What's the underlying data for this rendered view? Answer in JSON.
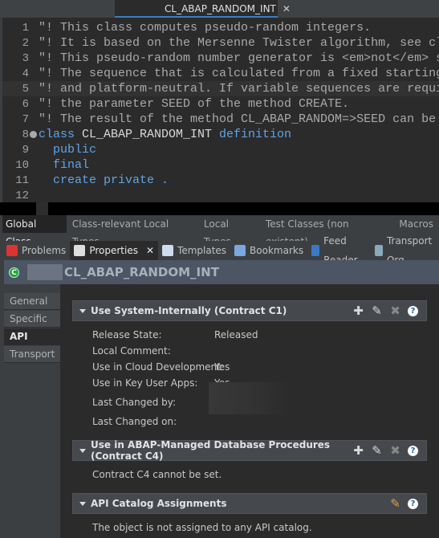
{
  "editor": {
    "tab_title": "CL_ABAP_RANDOM_INT",
    "lines": [
      {
        "n": "1",
        "parts": [
          [
            "cm",
            "\"! This class computes pseudo-random integers."
          ]
        ]
      },
      {
        "n": "2",
        "parts": [
          [
            "cm",
            "\"! It is based on the Mersenne Twister algorithm, see cl"
          ]
        ]
      },
      {
        "n": "3",
        "parts": [
          [
            "cm",
            "\"! This pseudo-random number generator is <em>not</em> s"
          ]
        ]
      },
      {
        "n": "4",
        "parts": [
          [
            "cm",
            "\"! The sequence that is calculated from a fixed starting"
          ]
        ]
      },
      {
        "n": "5",
        "parts": [
          [
            "cm",
            "\"! and platform-neutral. If variable sequences are requi"
          ]
        ]
      },
      {
        "n": "6",
        "parts": [
          [
            "cm",
            "\"! the parameter SEED of the method CREATE."
          ]
        ]
      },
      {
        "n": "7",
        "parts": [
          [
            "cm",
            "\"! The result of the method CL_ABAP_RANDOM=>SEED can be"
          ]
        ]
      },
      {
        "n": "8",
        "parts": [
          [
            "kw",
            "class "
          ],
          [
            "id",
            "CL_ABAP_RANDOM_INT "
          ],
          [
            "kw",
            "definition"
          ]
        ]
      },
      {
        "n": "9",
        "parts": [
          [
            "kw",
            "  public"
          ]
        ]
      },
      {
        "n": "10",
        "parts": [
          [
            "kw",
            "  final"
          ]
        ]
      },
      {
        "n": "11",
        "parts": [
          [
            "kw",
            "  create private ."
          ]
        ]
      },
      {
        "n": "12",
        "parts": []
      }
    ]
  },
  "subtabs": [
    "Global Class",
    "Class-relevant Local Types",
    "Local Types",
    "Test Classes (non existent)",
    "Macros"
  ],
  "viewtabs": [
    {
      "label": "Problems",
      "icon": "problems-icon",
      "color": "#d33"
    },
    {
      "label": "Properties",
      "icon": "properties-icon",
      "color": "#ddd"
    },
    {
      "label": "Templates",
      "icon": "templates-icon",
      "color": "#cde"
    },
    {
      "label": "Bookmarks",
      "icon": "bookmarks-icon",
      "color": "#7aa7e0"
    },
    {
      "label": "Feed Reader",
      "icon": "feed-icon",
      "color": "#3a78c8"
    },
    {
      "label": "Transport Org",
      "icon": "transport-icon",
      "color": "#8ab"
    }
  ],
  "properties": {
    "class_icon": "C",
    "title": "CL_ABAP_RANDOM_INT",
    "nav": [
      "General",
      "Specific",
      "API State",
      "Transport"
    ],
    "sections": [
      {
        "title": "Use System-Internally (Contract C1)",
        "fields": [
          [
            "Release State:",
            "Released"
          ],
          [
            "Local Comment:",
            ""
          ],
          [
            "Use in Cloud Development:",
            "Yes"
          ],
          [
            "Use in Key User Apps:",
            "Yes"
          ],
          [
            "Last Changed by:",
            ""
          ],
          [
            "Last Changed on:",
            ""
          ]
        ]
      },
      {
        "title": "Use in ABAP-Managed Database Procedures (Contract C4)",
        "text": "Contract C4 cannot be set."
      },
      {
        "title": "API Catalog Assignments",
        "text": "The object is not assigned to any API catalog."
      }
    ]
  }
}
